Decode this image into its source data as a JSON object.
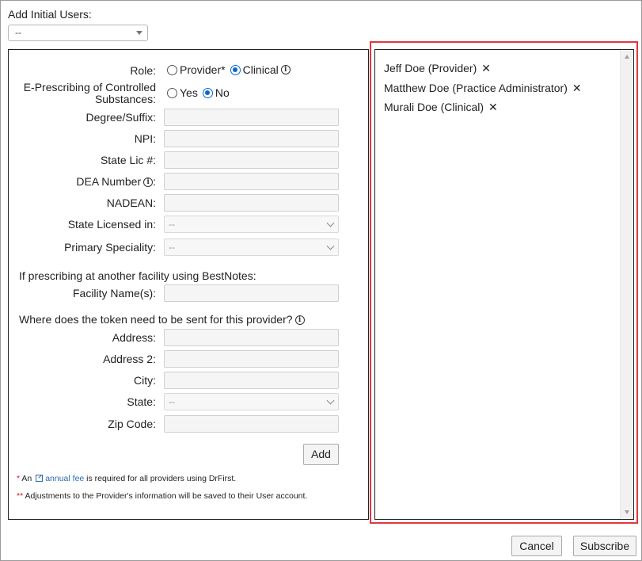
{
  "header": {
    "title": "Add Initial Users:",
    "select_value": "--"
  },
  "form": {
    "role_label": "Role:",
    "role_options": [
      "Provider*",
      "Clinical"
    ],
    "role_selected": "Clinical",
    "eprescribing_label_line1": "E-Prescribing of Controlled",
    "eprescribing_label_line2": "Substances:",
    "eprescribing_options": [
      "Yes",
      "No"
    ],
    "eprescribing_selected": "No",
    "degree_label": "Degree/Suffix:",
    "npi_label": "NPI:",
    "state_lic_label": "State Lic #:",
    "dea_label": "DEA Number",
    "nadean_label": "NADEAN:",
    "state_licensed_label": "State Licensed in:",
    "state_licensed_value": "--",
    "primary_speciality_label": "Primary Speciality:",
    "primary_speciality_value": "--",
    "other_facility_text": "If prescribing at another facility using BestNotes:",
    "facility_label": "Facility Name(s):",
    "token_text": "Where does the token need to be sent for this provider?",
    "address_label": "Address:",
    "address2_label": "Address 2:",
    "city_label": "City:",
    "state_label": "State:",
    "state_value": "--",
    "zip_label": "Zip Code:",
    "add_button": "Add",
    "note1_star": "*",
    "note1_pre": " An ",
    "note1_link": "annual fee",
    "note1_post": " is required for all providers using DrFirst.",
    "note2_star": "**",
    "note2_text": " Adjustments to the Provider's information will be saved to their User account."
  },
  "users": [
    {
      "label": "Jeff Doe (Provider)",
      "remove": "✕"
    },
    {
      "label": "Matthew Doe (Practice Administrator)",
      "remove": "✕"
    },
    {
      "label": "Murali Doe (Clinical)",
      "remove": "✕"
    }
  ],
  "footer": {
    "cancel_label": "Cancel",
    "subscribe_label": "Subscribe"
  },
  "colors": {
    "highlight": "#e0383e",
    "radio_accent": "#0b67d0",
    "link": "#2a6ab6"
  }
}
